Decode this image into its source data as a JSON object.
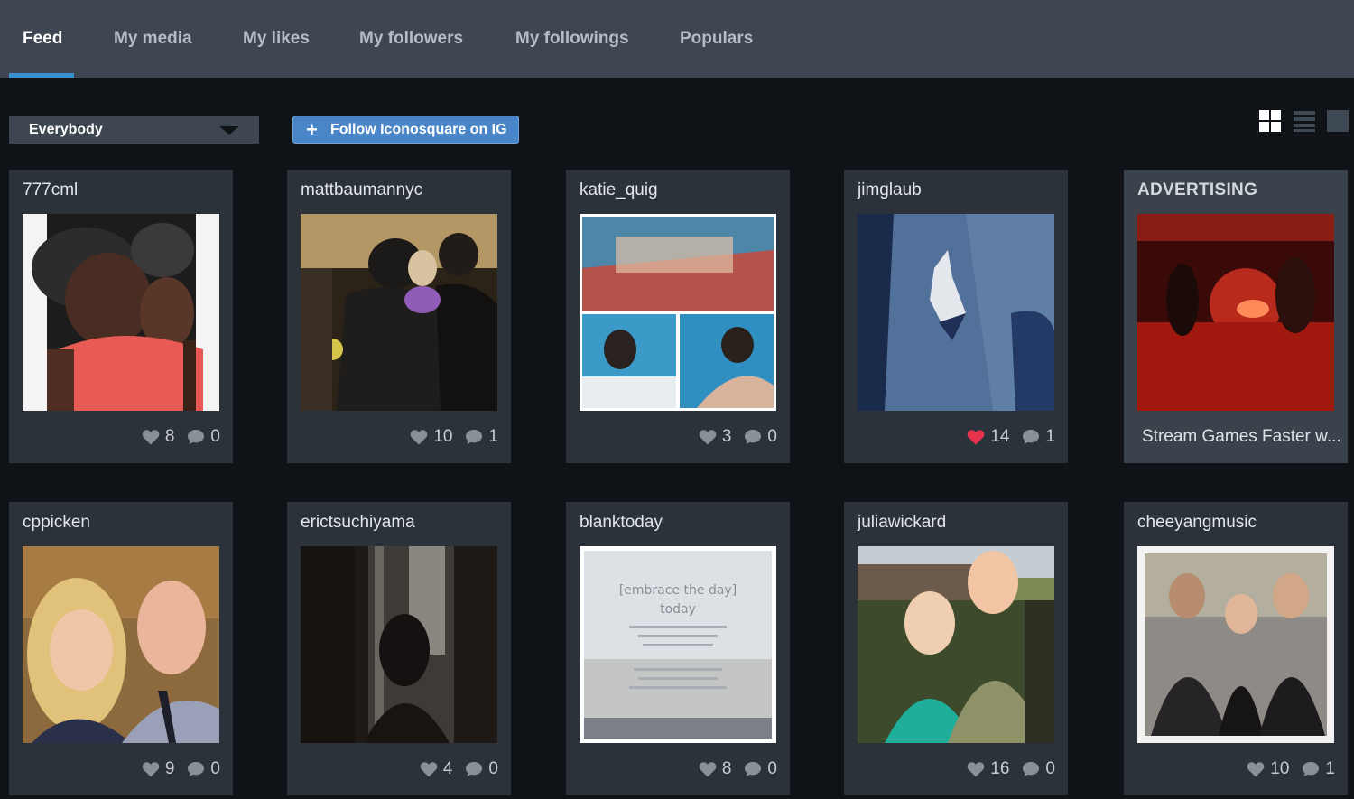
{
  "nav": {
    "tabs": [
      {
        "label": "Feed",
        "active": true
      },
      {
        "label": "My media"
      },
      {
        "label": "My likes"
      },
      {
        "label": "My followers"
      },
      {
        "label": "My followings"
      },
      {
        "label": "Populars"
      }
    ]
  },
  "toolbar": {
    "filter_value": "Everybody",
    "follow_label": "Follow Iconosquare on IG",
    "view_icons": [
      "grid-view-icon",
      "list-view-icon",
      "single-view-icon"
    ]
  },
  "cards": [
    {
      "user": "777cml",
      "likes": "8",
      "comments": "0"
    },
    {
      "user": "mattbaumannyc",
      "likes": "10",
      "comments": "1"
    },
    {
      "user": "katie_quig",
      "likes": "3",
      "comments": "0"
    },
    {
      "user": "jimglaub",
      "likes": "14",
      "comments": "1",
      "liked": true
    },
    {
      "user": "cppicken",
      "likes": "9",
      "comments": "0"
    },
    {
      "user": "erictsuchiyama",
      "likes": "4",
      "comments": "0"
    },
    {
      "user": "blanktoday",
      "likes": "8",
      "comments": "0"
    },
    {
      "user": "juliawickard",
      "likes": "16",
      "comments": "0"
    },
    {
      "user": "cheeyangmusic",
      "likes": "10",
      "comments": "1"
    }
  ],
  "ad": {
    "heading": "ADVERTISING",
    "caption": "Stream Games Faster w..."
  },
  "photo_texts": {
    "blanktoday_line1": "[embrace the day]",
    "blanktoday_line2": "today"
  },
  "colors": {
    "accent": "#3a91cf",
    "liked_heart": "#e8334f",
    "card_bg": "#2b323a",
    "nav_bg": "#3d4651"
  }
}
